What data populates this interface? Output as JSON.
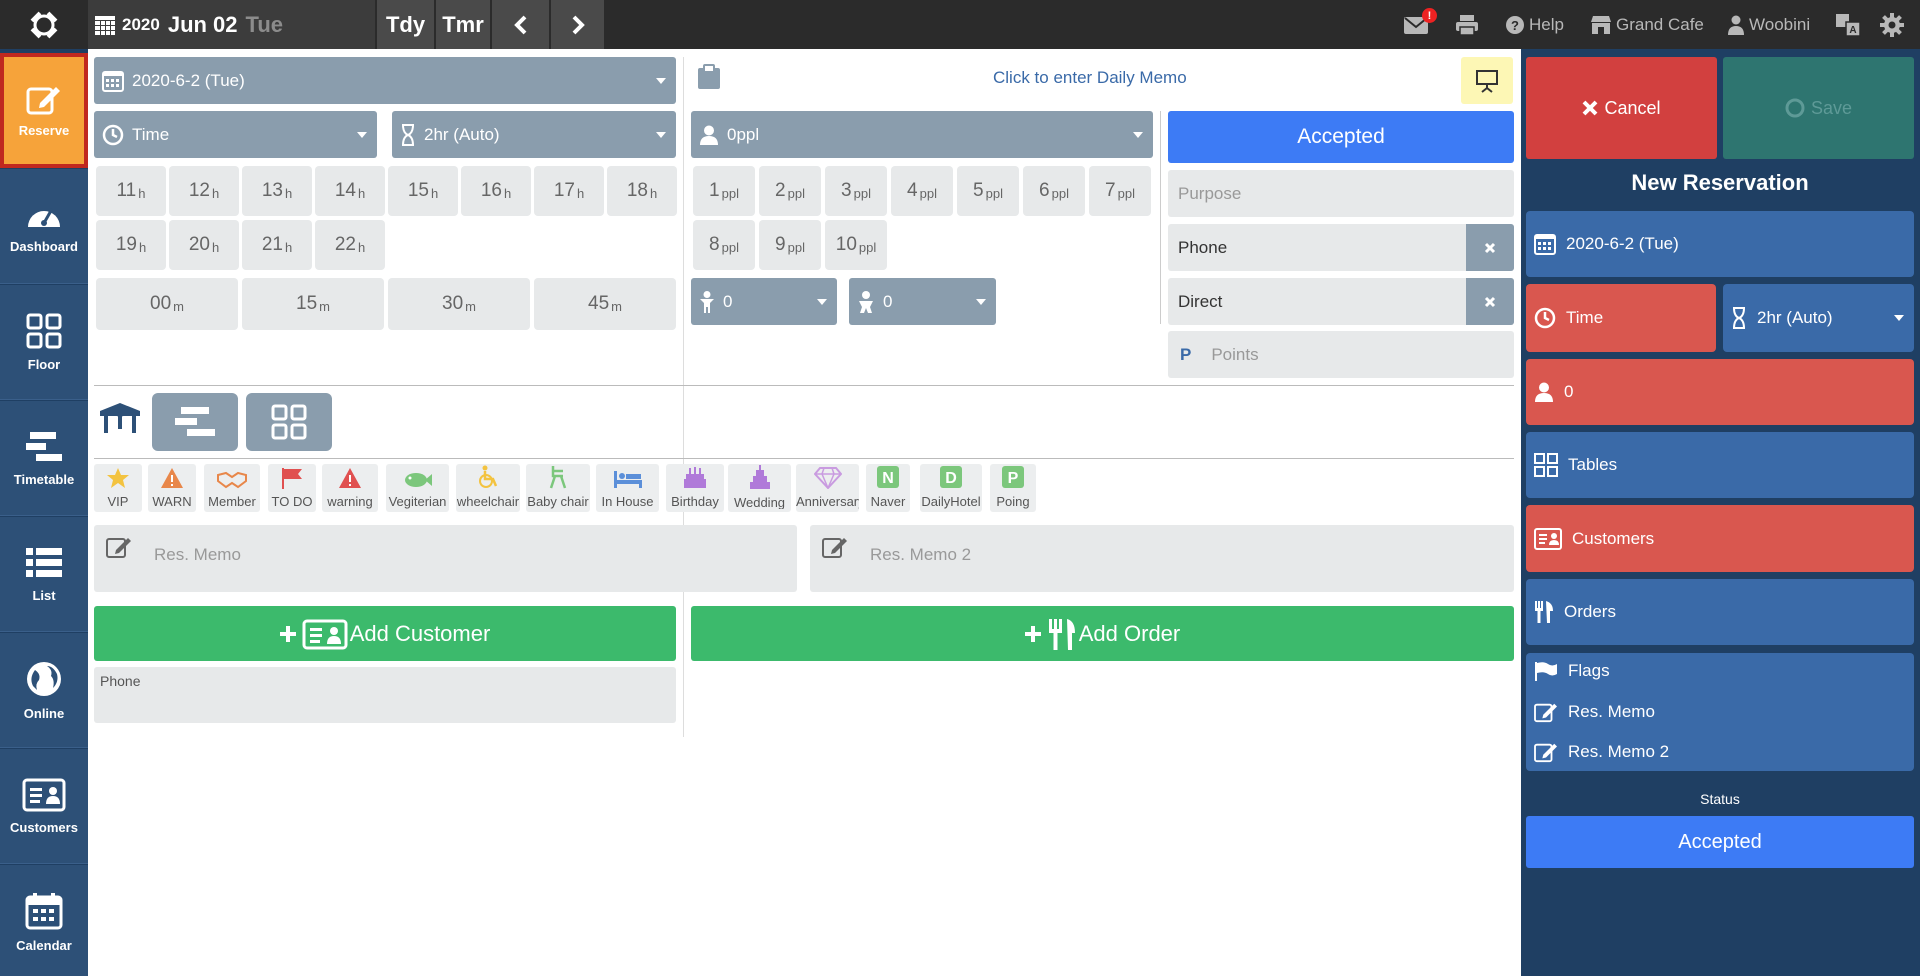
{
  "topbar": {
    "year": "2020",
    "month_day": "Jun 02",
    "weekday": "Tue",
    "today_label": "Tdy",
    "tomorrow_label": "Tmr",
    "mail_badge": "!",
    "help_label": "Help",
    "store_label": "Grand Cafe",
    "user_label": "Woobini"
  },
  "sidebar": {
    "items": [
      {
        "label": "Reserve",
        "icon": "edit-icon"
      },
      {
        "label": "Dashboard",
        "icon": "dashboard-icon"
      },
      {
        "label": "Floor",
        "icon": "grid-icon"
      },
      {
        "label": "Timetable",
        "icon": "timetable-icon"
      },
      {
        "label": "List",
        "icon": "list-icon"
      },
      {
        "label": "Online",
        "icon": "globe-icon"
      },
      {
        "label": "Customers",
        "icon": "contact-card-icon"
      },
      {
        "label": "Calendar",
        "icon": "calendar-icon"
      }
    ]
  },
  "main": {
    "date_select": "2020-6-2 (Tue)",
    "time_select": "Time",
    "duration_select": "2hr (Auto)",
    "people_select": "0ppl",
    "daily_memo": "Click to enter Daily Memo",
    "status_button": "Accepted",
    "purpose_placeholder": "Purpose",
    "source_phone": "Phone",
    "source_direct": "Direct",
    "points_prefix": "P",
    "points_placeholder": "Points",
    "hours": [
      "11",
      "12",
      "13",
      "14",
      "15",
      "16",
      "17",
      "18",
      "19",
      "20",
      "21",
      "22"
    ],
    "hour_unit": "h",
    "minutes": [
      "00",
      "15",
      "30",
      "45"
    ],
    "minute_unit": "m",
    "people": [
      "1",
      "2",
      "3",
      "4",
      "5",
      "6",
      "7",
      "8",
      "9",
      "10"
    ],
    "people_unit": "ppl",
    "child_count": "0",
    "baby_count": "0",
    "flags": [
      {
        "label": "VIP",
        "icon": "star-icon",
        "color": "#f3c340"
      },
      {
        "label": "WARN",
        "icon": "warning-icon",
        "color": "#e8874a"
      },
      {
        "label": "Member",
        "icon": "handshake-icon",
        "color": "#e8874a"
      },
      {
        "label": "TO DO",
        "icon": "flag-icon",
        "color": "#e05050"
      },
      {
        "label": "warning",
        "icon": "warning-icon",
        "color": "#e05050"
      },
      {
        "label": "Vegiterian",
        "icon": "fish-icon",
        "color": "#7cc77c"
      },
      {
        "label": "wheelchair",
        "icon": "wheelchair-icon",
        "color": "#f3c340"
      },
      {
        "label": "Baby chair",
        "icon": "highchair-icon",
        "color": "#7cc77c"
      },
      {
        "label": "In House",
        "icon": "bed-icon",
        "color": "#5b8fd9"
      },
      {
        "label": "Birthday",
        "icon": "cake-icon",
        "color": "#b07ad9"
      },
      {
        "label": "Wedding",
        "icon": "wedding-cake-icon",
        "color": "#b07ad9"
      },
      {
        "label": "Anniversary",
        "icon": "diamond-icon",
        "color": "#c99be0"
      },
      {
        "label": "Naver",
        "icon": "letter-n-icon",
        "color": "#7cc77c"
      },
      {
        "label": "DailyHotel",
        "icon": "letter-d-icon",
        "color": "#7cc77c"
      },
      {
        "label": "Poing",
        "icon": "letter-p-icon",
        "color": "#7cc77c"
      }
    ],
    "memo_placeholder": "Res. Memo",
    "memo2_placeholder": "Res. Memo 2",
    "add_customer_label": "Add Customer",
    "add_order_label": "Add Order",
    "customer_phone_label": "Phone"
  },
  "right_panel": {
    "cancel_label": "Cancel",
    "save_label": "Save",
    "title": "New Reservation",
    "date": "2020-6-2 (Tue)",
    "time": "Time",
    "duration": "2hr (Auto)",
    "people": "0",
    "tables_label": "Tables",
    "customers_label": "Customers",
    "orders_label": "Orders",
    "flags_label": "Flags",
    "memo_label": "Res. Memo",
    "memo2_label": "Res. Memo 2",
    "status_label": "Status",
    "status_value": "Accepted"
  },
  "colors": {
    "accent_blue": "#3d7bf5",
    "green": "#3cba6c",
    "red": "#d9574f",
    "sidebar": "#2d5077",
    "active_orange": "#f6a33a"
  }
}
